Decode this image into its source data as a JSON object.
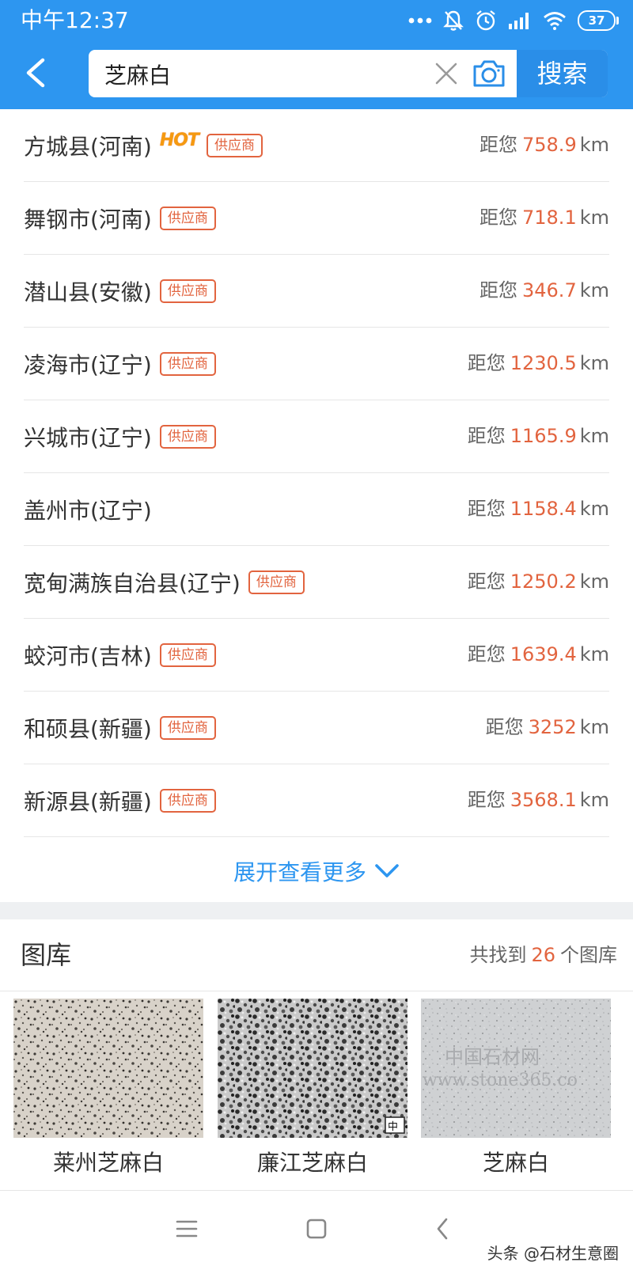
{
  "status_bar": {
    "time": "中午12:37",
    "battery": "37",
    "icons": [
      "more-dots-icon",
      "mute-bell-icon",
      "alarm-icon",
      "signal-icon",
      "wifi-icon",
      "battery-icon"
    ]
  },
  "search": {
    "query": "芝麻白",
    "button_label": "搜索",
    "icons": [
      "back-arrow-icon",
      "clear-icon",
      "camera-icon"
    ]
  },
  "results": [
    {
      "name": "方城县(河南)",
      "hot": "HOT",
      "badge": "供应商",
      "label": "距您",
      "distance": "758.9",
      "unit": "km"
    },
    {
      "name": "舞钢市(河南)",
      "badge": "供应商",
      "label": "距您",
      "distance": "718.1",
      "unit": "km"
    },
    {
      "name": "潜山县(安徽)",
      "badge": "供应商",
      "label": "距您",
      "distance": "346.7",
      "unit": "km"
    },
    {
      "name": "凌海市(辽宁)",
      "badge": "供应商",
      "label": "距您",
      "distance": "1230.5",
      "unit": "km"
    },
    {
      "name": "兴城市(辽宁)",
      "badge": "供应商",
      "label": "距您",
      "distance": "1165.9",
      "unit": "km"
    },
    {
      "name": "盖州市(辽宁)",
      "label": "距您",
      "distance": "1158.4",
      "unit": "km"
    },
    {
      "name": "宽甸满族自治县(辽宁)",
      "badge": "供应商",
      "label": "距您",
      "distance": "1250.2",
      "unit": "km"
    },
    {
      "name": "蛟河市(吉林)",
      "badge": "供应商",
      "label": "距您",
      "distance": "1639.4",
      "unit": "km"
    },
    {
      "name": "和硕县(新疆)",
      "badge": "供应商",
      "label": "距您",
      "distance": "3252",
      "unit": "km"
    },
    {
      "name": "新源县(新疆)",
      "badge": "供应商",
      "label": "距您",
      "distance": "3568.1",
      "unit": "km"
    }
  ],
  "expand": {
    "label": "展开查看更多"
  },
  "gallery": {
    "title": "图库",
    "count_prefix": "共找到",
    "count": "26",
    "count_suffix": "个图库",
    "items": [
      {
        "caption": "莱州芝麻白"
      },
      {
        "caption": "廉江芝麻白"
      },
      {
        "caption": "芝麻白",
        "watermark_line1": "中国石材网",
        "watermark_line2": "www.stone365.co"
      }
    ]
  },
  "nav": {
    "icons": [
      "menu-icon",
      "home-square-icon",
      "back-chevron-icon"
    ]
  },
  "footer": {
    "credit": "头条 @石材生意圈"
  },
  "colors": {
    "header_blue": "#2d96f0",
    "accent_orange": "#e2643f",
    "hot_yellow": "#f59a10"
  }
}
